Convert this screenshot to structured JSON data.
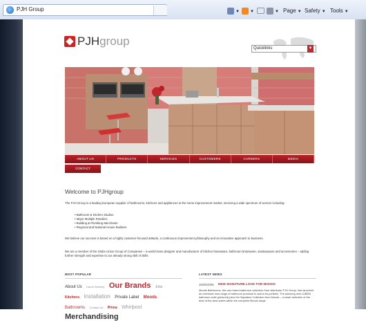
{
  "browser": {
    "tab_title": "PJH Group",
    "toolbar": {
      "page": "Page",
      "safety": "Safety",
      "tools": "Tools"
    }
  },
  "site": {
    "logo_bold": "PJH",
    "logo_light": "group",
    "quick_links": "Quicklinks",
    "nav": [
      "ABOUT US",
      "PRODUCTS",
      "SERVICES",
      "CUSTOMERS",
      "CAREERS",
      "MEDIA"
    ],
    "nav_second_row": "CONTACT",
    "welcome_heading": "Welcome to PJHgroup",
    "intro": "The PJH Group is a leading European supplier of bathrooms, kitchens and appliances to the home improvement market, servicing a wide spectrum of sectors including:",
    "sectors": [
      "Bathroom & Kitchen Studios",
      "Major Multiple Retailers",
      "Building & Plumbing Merchants",
      "Regional and National House Builders"
    ],
    "para2": "We believe our success is based on a highly customer-focused attitude, a continuous improvement philosophy and an innovative approach to business.",
    "para3": "We are a member of the Globe Union Group of Companies – a world-class designer and manufacturer of kitchen brassware, bathroom brassware, sanitaryware and accessories – adding further strength and expertise to our already strong skill of skills.",
    "most_popular_heading": "MOST POPULAR",
    "latest_news_heading": "LATEST NEWS",
    "tag_cloud": [
      {
        "text": "About Us",
        "size": 6,
        "color": "#333333",
        "bold": false
      },
      {
        "text": "Home Delivery",
        "size": 4,
        "color": "#888888",
        "bold": false
      },
      {
        "text": "Our Brands",
        "size": 11,
        "color": "#c1272d",
        "bold": true
      },
      {
        "text": "Jobs",
        "size": 5,
        "color": "#888888",
        "bold": false
      },
      {
        "text": "Kitchens",
        "size": 5,
        "color": "#c1272d",
        "bold": true
      },
      {
        "text": "Installation",
        "size": 8,
        "color": "#999999",
        "bold": false
      },
      {
        "text": "Private Label",
        "size": 6,
        "color": "#333333",
        "bold": false
      },
      {
        "text": "Moods",
        "size": 6,
        "color": "#c1272d",
        "bold": true
      },
      {
        "text": "Bathrooms",
        "size": 6,
        "color": "#c1272d",
        "bold": false
      },
      {
        "text": "Contact Us",
        "size": 4,
        "color": "#888888",
        "bold": false
      },
      {
        "text": "Prima",
        "size": 5,
        "color": "#c1272d",
        "bold": true
      },
      {
        "text": "Whirlpool",
        "size": 7,
        "color": "#999999",
        "bold": false
      },
      {
        "text": "Merchandising",
        "size": 11,
        "color": "#333333",
        "bold": true
      }
    ],
    "news": {
      "date": "26/06/2009",
      "title": "NEW SIGNATURE LOOK FOR MOODS",
      "body": "Moods Bathrooms, the own-brand bathroom collection from distributor PJH Group, has launched an extensive new range of bathroom products to add to its portfolio. The stunning new LUBRA bathroom suite (pictured) joins the Signature Collection from Moods – a smart selection of the best-of-the-best suites within the complete Moods range."
    }
  },
  "colors": {
    "brand_red": "#c1272d",
    "nav_red": "#a3191f"
  }
}
